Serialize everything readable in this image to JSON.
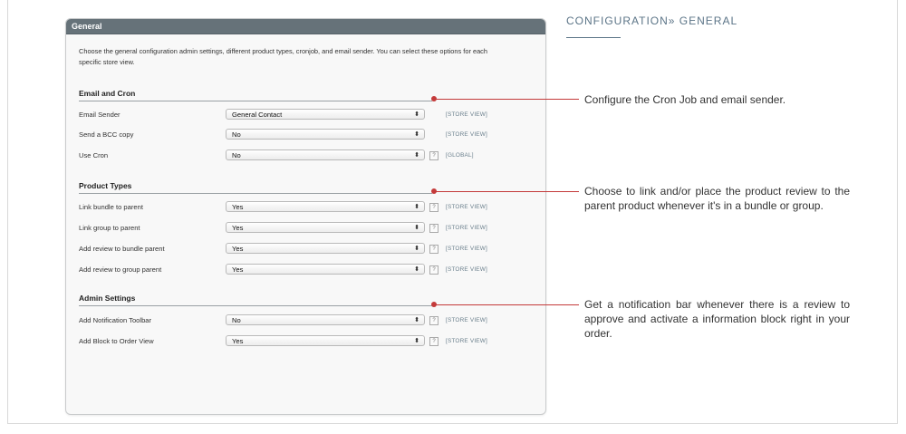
{
  "panel": {
    "header": "General",
    "description": "Choose the general configuration admin settings, different product types, cronjob, and email sender. You can select these options for each specific store view."
  },
  "sections": {
    "email_cron": {
      "title": "Email and Cron",
      "rows": [
        {
          "label": "Email Sender",
          "value": "General Contact",
          "scope": "[STORE VIEW]"
        },
        {
          "label": "Send a BCC copy",
          "value": "No",
          "scope": "[STORE VIEW]"
        },
        {
          "label": "Use Cron",
          "value": "No",
          "scope": "[GLOBAL]"
        }
      ]
    },
    "product_types": {
      "title": "Product Types",
      "rows": [
        {
          "label": "Link bundle to parent",
          "value": "Yes",
          "scope": "[STORE VIEW]"
        },
        {
          "label": "Link group to parent",
          "value": "Yes",
          "scope": "[STORE VIEW]"
        },
        {
          "label": "Add review to bundle parent",
          "value": "Yes",
          "scope": "[STORE VIEW]"
        },
        {
          "label": "Add review to group parent",
          "value": "Yes",
          "scope": "[STORE VIEW]"
        }
      ]
    },
    "admin_settings": {
      "title": "Admin Settings",
      "rows": [
        {
          "label": "Add Notification Toolbar",
          "value": "No",
          "scope": "[STORE VIEW]"
        },
        {
          "label": "Add Block to Order View",
          "value": "Yes",
          "scope": "[STORE VIEW]"
        }
      ]
    }
  },
  "help_glyph": "?",
  "select_arrow": "⬍",
  "config_title": "CONFIGURATION» GENERAL",
  "annotations": {
    "cron": "Configure the Cron Job and email sender.",
    "product": "Choose to link and/or place the product review to the parent product whenever it's in a bundle or group.",
    "admin": "Get a notification bar whenever there is a review to approve and activate a information block right in your order."
  },
  "colors": {
    "header_bg": "#667279",
    "accent_red": "#c43a3a",
    "title_blue": "#5b7487"
  }
}
